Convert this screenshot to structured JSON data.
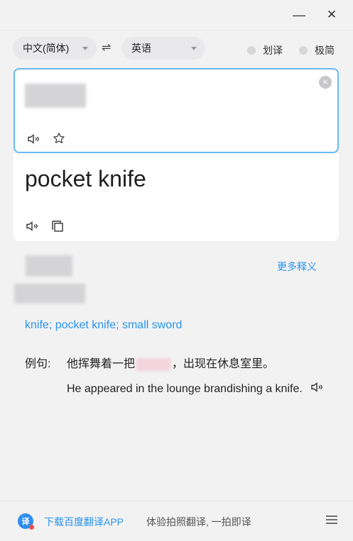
{
  "window": {
    "minimize_glyph": "—",
    "close_glyph": "✕"
  },
  "langbar": {
    "source_lang": "中文(简体)",
    "target_lang": "英语",
    "swap_glyph": "⇌",
    "toggle_select": "划译",
    "toggle_minimal": "极简"
  },
  "input": {
    "clear_glyph": "×"
  },
  "output": {
    "translation": "pocket knife"
  },
  "dictionary": {
    "more_meanings": "更多释义",
    "meanings": [
      "knife",
      "pocket knife",
      "small sword"
    ],
    "separator": "; ",
    "example_label": "例句:",
    "example_cn_before": "他挥舞着一把",
    "example_cn_after": "，出现在休息室里。",
    "example_en": "He appeared in the lounge brandishing a knife."
  },
  "footer": {
    "download_link": "下载百度翻译APP",
    "slogan": "体验拍照翻译, 一拍即译",
    "logo_glyph": "译"
  },
  "colors": {
    "accent": "#2b93e8",
    "input_border": "#69b9f5"
  }
}
